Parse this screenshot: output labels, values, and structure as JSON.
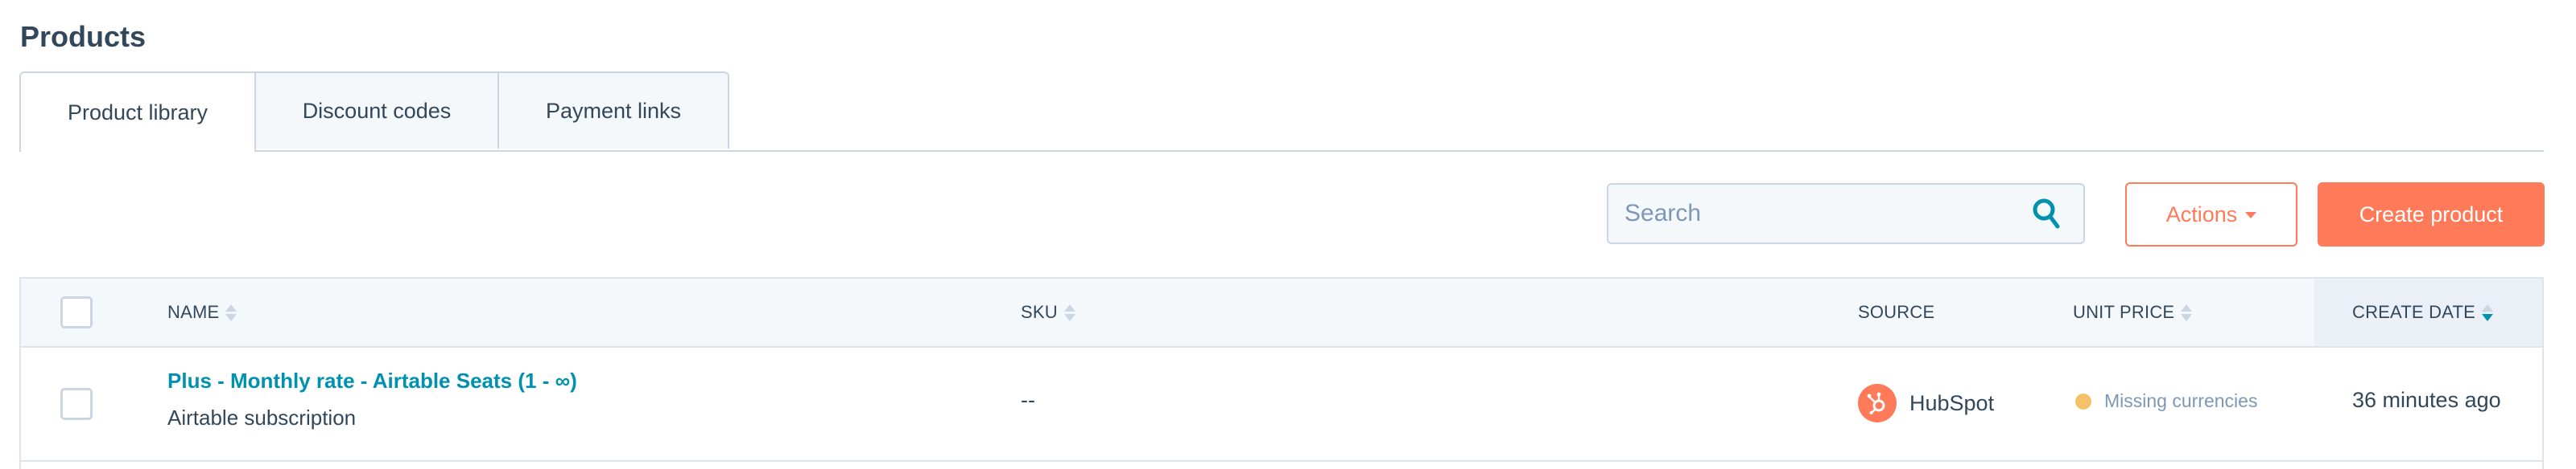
{
  "page": {
    "title": "Products"
  },
  "tabs": [
    {
      "label": "Product library",
      "active": true
    },
    {
      "label": "Discount codes",
      "active": false
    },
    {
      "label": "Payment links",
      "active": false
    }
  ],
  "toolbar": {
    "search_placeholder": "Search",
    "search_value": "",
    "actions_label": "Actions",
    "create_label": "Create product"
  },
  "table": {
    "columns": [
      {
        "label": "NAME",
        "sortable": true,
        "sort": "none"
      },
      {
        "label": "SKU",
        "sortable": true,
        "sort": "none"
      },
      {
        "label": "SOURCE",
        "sortable": false,
        "sort": "none"
      },
      {
        "label": "UNIT PRICE",
        "sortable": true,
        "sort": "none"
      },
      {
        "label": "CREATE DATE",
        "sortable": true,
        "sort": "descending"
      }
    ],
    "rows": [
      {
        "name": "Plus - Monthly rate - Airtable Seats (1 - ∞)",
        "description": "Airtable subscription",
        "sku": "--",
        "source": "HubSpot",
        "source_icon": "hubspot-sprocket-icon",
        "unit_price_status": "Missing currencies",
        "create_date": "36 minutes ago"
      }
    ]
  },
  "colors": {
    "accent": "#ff7a59",
    "link": "#0091ae",
    "text": "#33475b",
    "muted": "#7c98b6",
    "border": "#cbd6e2",
    "warning_dot": "#f5c26b"
  }
}
